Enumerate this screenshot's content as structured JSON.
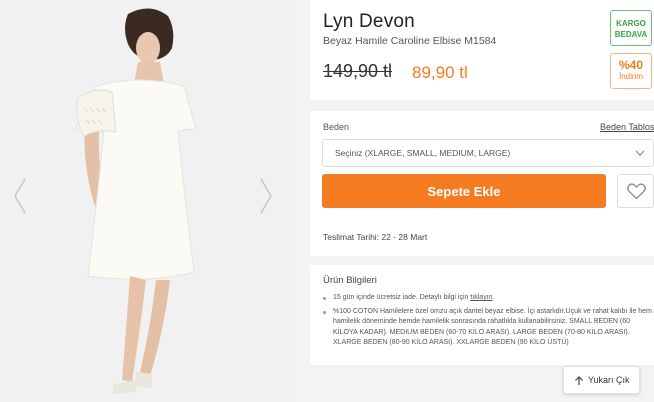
{
  "product": {
    "brand": "Lyn Devon",
    "name": "Beyaz Hamile Caroline Elbise M1584",
    "old_price": "149,90 tl",
    "new_price": "89,90 tl",
    "badges": {
      "kargo_line1": "KARGO",
      "kargo_line2": "BEDAVA",
      "discount_pct": "%40",
      "discount_label": "İndirim"
    }
  },
  "purchase": {
    "size_label": "Beden",
    "size_table_link": "Beden Tablosu",
    "size_select_value": "Seçiniz (XLARGE, SMALL, MEDIUM, LARGE)",
    "add_to_cart": "Sepete Ekle",
    "delivery": "Teslimat Tarihi: 22 - 28 Mart"
  },
  "info": {
    "title": "Ürün Bilgileri",
    "return_text": "15 gün içinde ücretsiz iade. Detaylı bilgi için ",
    "return_link": "tıklayın",
    "return_suffix": ".",
    "description": "%100 COTON Hamilelere özel omzu açık dantel beyaz elbise. İçi astarlıdır.Uçuk ve rahat kalıbı ile hem hamilelik döneminde hemde hamilelik sonrasında rahatlıkla kullanabilirsiniz. SMALL BEDEN (60 KİLOYA KADAR). MEDIUM BEDEN (60-70 KİLO ARASI). LARGE BEDEN (70-80 KİLO ARASI). XLARGE BEDEN (80-90 KİLO ARASI). XXLARGE BEDEN (90 KİLO ÜSTÜ)"
  },
  "back_to_top": "Yukarı Çık",
  "icons": {
    "prev": "chevron-left-icon",
    "next": "chevron-right-icon",
    "select": "chevron-down-icon",
    "favorite": "heart-icon",
    "back_to_top": "arrow-up-icon"
  },
  "colors": {
    "accent": "#f47b20",
    "free_shipping": "#3aa441",
    "background": "#f3f3f3"
  }
}
